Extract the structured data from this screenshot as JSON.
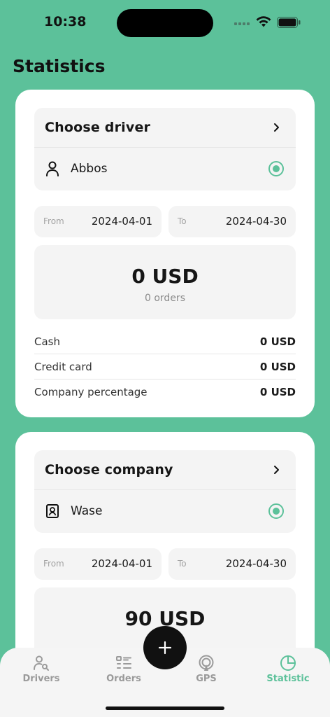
{
  "status": {
    "time": "10:38"
  },
  "page": {
    "title": "Statistics"
  },
  "driver_card": {
    "select_title": "Choose driver",
    "selected": "Abbos",
    "selected_icon": "person-icon",
    "from_label": "From",
    "from_value": "2024-04-01",
    "to_label": "To",
    "to_value": "2024-04-30",
    "total": "0 USD",
    "orders": "0 orders",
    "breakdown": [
      {
        "label": "Cash",
        "value": "0 USD"
      },
      {
        "label": "Credit card",
        "value": "0 USD"
      },
      {
        "label": "Company percentage",
        "value": "0 USD"
      }
    ]
  },
  "company_card": {
    "select_title": "Choose company",
    "selected": "Wase",
    "selected_icon": "company-badge-icon",
    "from_label": "From",
    "from_value": "2024-04-01",
    "to_label": "To",
    "to_value": "2024-04-30",
    "total": "90 USD"
  },
  "tabs": [
    {
      "label": "Drivers",
      "icon": "driver-search-icon",
      "active": false
    },
    {
      "label": "Orders",
      "icon": "orders-list-icon",
      "active": false
    },
    {
      "label": "GPS",
      "icon": "gps-icon",
      "active": false
    },
    {
      "label": "Statistic",
      "icon": "pie-chart-icon",
      "active": true
    }
  ],
  "fab": {
    "icon": "plus-icon"
  },
  "colors": {
    "accent": "#5cc19a",
    "card": "#ffffff",
    "field": "#f4f4f4",
    "fab": "#111111"
  }
}
